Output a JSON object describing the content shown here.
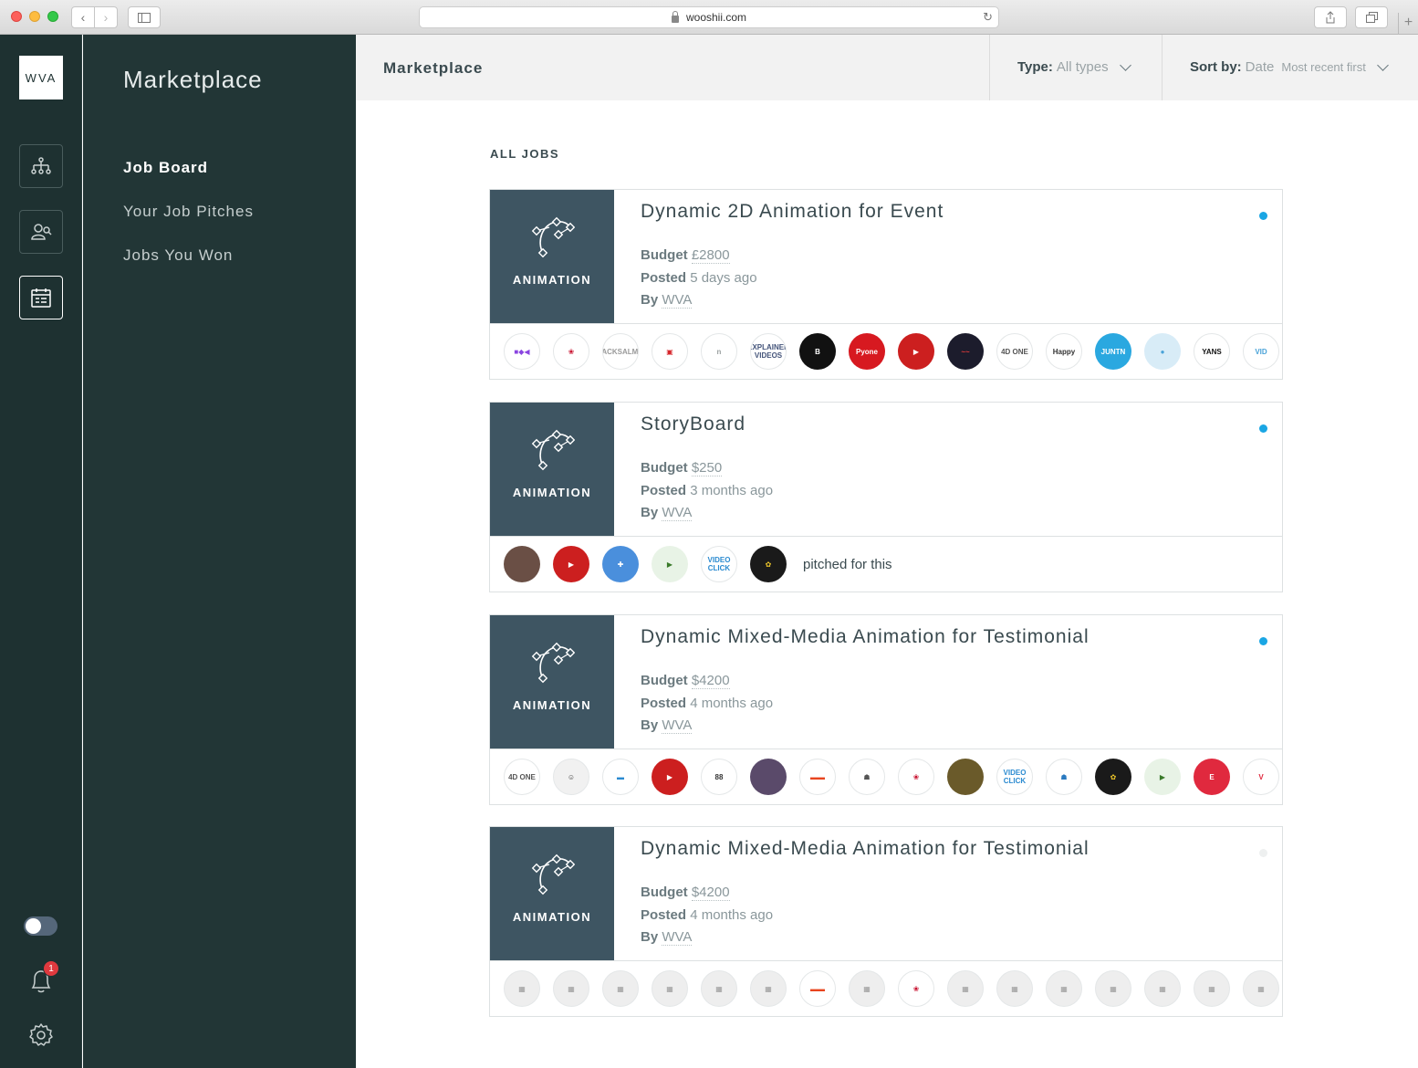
{
  "browser": {
    "url": "wooshii.com"
  },
  "rail": {
    "logo": "WVA",
    "notification_count": "1"
  },
  "sidebar": {
    "title": "Marketplace",
    "items": [
      {
        "label": "Job Board",
        "active": true
      },
      {
        "label": "Your Job Pitches",
        "active": false
      },
      {
        "label": "Jobs You Won",
        "active": false
      }
    ]
  },
  "topbar": {
    "title": "Marketplace",
    "type_label": "Type:",
    "type_value": "All types",
    "sort_label": "Sort by:",
    "sort_value": "Date",
    "sort_order": "Most recent first"
  },
  "main": {
    "section_label": "ALL JOBS",
    "budget_label": "Budget",
    "posted_label": "Posted",
    "by_label": "By",
    "jobs": [
      {
        "category": "ANIMATION",
        "title": "Dynamic 2D Animation for Event",
        "budget": "£2800",
        "posted": "5 days ago",
        "by": "WVA",
        "unread": true,
        "pitch_text": "",
        "avatars": [
          {
            "bg": "#ffffff",
            "fg": "#8a45e0",
            "t": "■◆◀"
          },
          {
            "bg": "#ffffff",
            "fg": "#c8102e",
            "t": "❀"
          },
          {
            "bg": "#ffffff",
            "fg": "#999999",
            "t": "BLACKSALMON"
          },
          {
            "bg": "#ffffff",
            "fg": "#d6262b",
            "t": "▣"
          },
          {
            "bg": "#ffffff",
            "fg": "#9aa0a0",
            "t": "n"
          },
          {
            "bg": "#ffffff",
            "fg": "#44547a",
            "t": "EXPLAINER VIDEOS"
          },
          {
            "bg": "#111111",
            "fg": "#ffffff",
            "t": "B"
          },
          {
            "bg": "#d71920",
            "fg": "#ffffff",
            "t": "Pyone"
          },
          {
            "bg": "#cc1f1f",
            "fg": "#ffffff",
            "t": "▶"
          },
          {
            "bg": "#1c1c2c",
            "fg": "#e23a3a",
            "t": "~~"
          },
          {
            "bg": "#ffffff",
            "fg": "#555555",
            "t": "4D ONE"
          },
          {
            "bg": "#ffffff",
            "fg": "#333333",
            "t": "Happy"
          },
          {
            "bg": "#2aa8e0",
            "fg": "#ffffff",
            "t": "JUNTN"
          },
          {
            "bg": "#d8ecf7",
            "fg": "#4aa3d8",
            "t": "●"
          },
          {
            "bg": "#ffffff",
            "fg": "#111111",
            "t": "YANS"
          },
          {
            "bg": "#ffffff",
            "fg": "#4aa3d8",
            "t": "VID"
          }
        ]
      },
      {
        "category": "ANIMATION",
        "title": "StoryBoard",
        "budget": "$250",
        "posted": "3 months ago",
        "by": "WVA",
        "unread": true,
        "pitch_text": "pitched for this",
        "avatars": [
          {
            "bg": "#6a4f45",
            "fg": "#ffffff",
            "t": ""
          },
          {
            "bg": "#cc1f1f",
            "fg": "#ffffff",
            "t": "▶"
          },
          {
            "bg": "#4a8fdc",
            "fg": "#ffffff",
            "t": "✚"
          },
          {
            "bg": "#e8f3e6",
            "fg": "#3a7a2a",
            "t": "▶"
          },
          {
            "bg": "#ffffff",
            "fg": "#2a8ad0",
            "t": "VIDEO CLICK"
          },
          {
            "bg": "#1a1a1a",
            "fg": "#e8c22a",
            "t": "✿"
          }
        ]
      },
      {
        "category": "ANIMATION",
        "title": "Dynamic Mixed-Media Animation for Testimonial",
        "budget": "$4200",
        "posted": "4 months ago",
        "by": "WVA",
        "unread": true,
        "pitch_text": "",
        "avatars": [
          {
            "bg": "#ffffff",
            "fg": "#555555",
            "t": "4D ONE"
          },
          {
            "bg": "#f1f1f1",
            "fg": "#333333",
            "t": "☺"
          },
          {
            "bg": "#ffffff",
            "fg": "#2a8ad0",
            "t": "▬"
          },
          {
            "bg": "#cc1f1f",
            "fg": "#ffffff",
            "t": "▶"
          },
          {
            "bg": "#ffffff",
            "fg": "#333333",
            "t": "88"
          },
          {
            "bg": "#5a4a6a",
            "fg": "#ffffff",
            "t": ""
          },
          {
            "bg": "#ffffff",
            "fg": "#e8441e",
            "t": "▬▬"
          },
          {
            "bg": "#ffffff",
            "fg": "#555555",
            "t": "☗"
          },
          {
            "bg": "#ffffff",
            "fg": "#c8102e",
            "t": "❀"
          },
          {
            "bg": "#6a5a2a",
            "fg": "#ffffff",
            "t": ""
          },
          {
            "bg": "#ffffff",
            "fg": "#2a8ad0",
            "t": "VIDEO CLICK"
          },
          {
            "bg": "#ffffff",
            "fg": "#2a7ac0",
            "t": "☗"
          },
          {
            "bg": "#1a1a1a",
            "fg": "#e8c22a",
            "t": "✿"
          },
          {
            "bg": "#e8f3e6",
            "fg": "#3a7a2a",
            "t": "▶"
          },
          {
            "bg": "#e0293e",
            "fg": "#ffffff",
            "t": "E"
          },
          {
            "bg": "#ffffff",
            "fg": "#e0293e",
            "t": "V"
          }
        ]
      },
      {
        "category": "ANIMATION",
        "title": "Dynamic Mixed-Media Animation for Testimonial",
        "budget": "$4200",
        "posted": "4 months ago",
        "by": "WVA",
        "unread": false,
        "pitch_text": "",
        "avatars": [
          {
            "bg": "#eeeeee",
            "fg": "#999999",
            "t": "▦"
          },
          {
            "bg": "#eeeeee",
            "fg": "#999999",
            "t": "▦"
          },
          {
            "bg": "#eeeeee",
            "fg": "#999999",
            "t": "▦"
          },
          {
            "bg": "#eeeeee",
            "fg": "#999999",
            "t": "▦"
          },
          {
            "bg": "#eeeeee",
            "fg": "#999999",
            "t": "▦"
          },
          {
            "bg": "#eeeeee",
            "fg": "#999999",
            "t": "▦"
          },
          {
            "bg": "#ffffff",
            "fg": "#e8441e",
            "t": "▬▬"
          },
          {
            "bg": "#eeeeee",
            "fg": "#999999",
            "t": "▦"
          },
          {
            "bg": "#ffffff",
            "fg": "#c8102e",
            "t": "❀"
          },
          {
            "bg": "#eeeeee",
            "fg": "#999999",
            "t": "▦"
          },
          {
            "bg": "#eeeeee",
            "fg": "#999999",
            "t": "▦"
          },
          {
            "bg": "#eeeeee",
            "fg": "#999999",
            "t": "▦"
          },
          {
            "bg": "#eeeeee",
            "fg": "#999999",
            "t": "▦"
          },
          {
            "bg": "#eeeeee",
            "fg": "#999999",
            "t": "▦"
          },
          {
            "bg": "#eeeeee",
            "fg": "#999999",
            "t": "▦"
          },
          {
            "bg": "#eeeeee",
            "fg": "#999999",
            "t": "▦"
          }
        ]
      }
    ]
  }
}
